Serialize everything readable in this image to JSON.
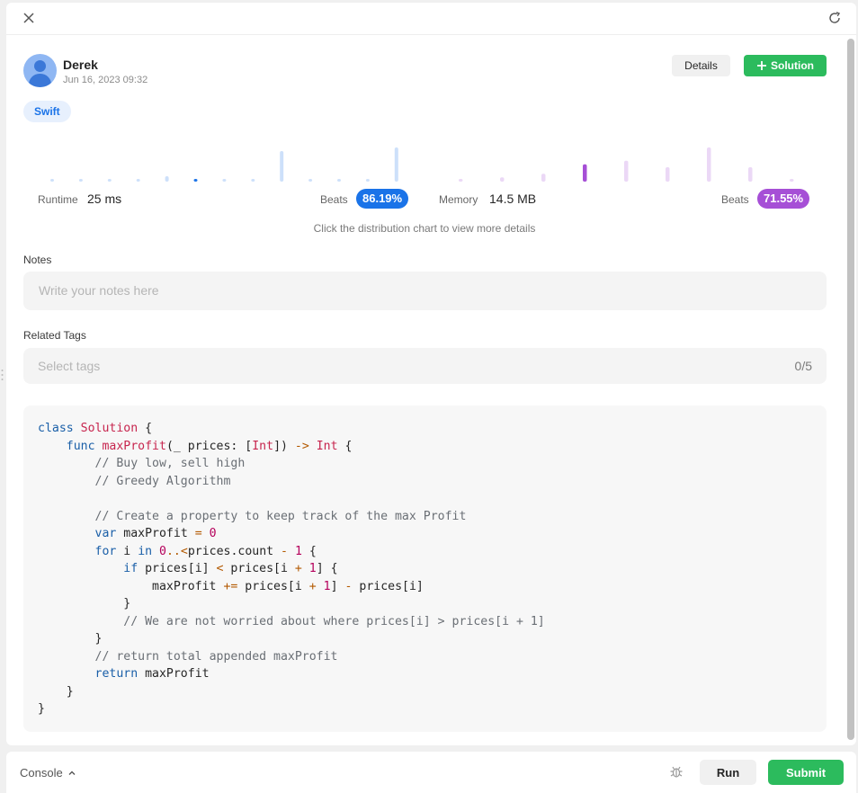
{
  "user": {
    "name": "Derek",
    "date": "Jun 16, 2023 09:32"
  },
  "actions": {
    "details_label": "Details",
    "solution_label": "Solution"
  },
  "language_tag": "Swift",
  "runtime": {
    "label": "Runtime",
    "value": "25 ms",
    "beats_label": "Beats",
    "beats_value": "86.19%",
    "accent": "#1a73e8",
    "bars": [
      0.04,
      0.04,
      0.04,
      0.04,
      0.15,
      0.07,
      0.04,
      0.06,
      0.85,
      0.04,
      0.04,
      0.06,
      0.95
    ],
    "highlight_index": 5
  },
  "memory": {
    "label": "Memory",
    "value": "14.5 MB",
    "beats_label": "Beats",
    "beats_value": "71.55%",
    "accent": "#a64fd6",
    "bars": [
      0.04,
      0.12,
      0.22,
      0.48,
      0.58,
      0.4,
      0.95,
      0.4,
      0.04
    ],
    "highlight_index": 3
  },
  "chart_hint": "Click the distribution chart to view more details",
  "notes": {
    "label": "Notes",
    "placeholder": "Write your notes here"
  },
  "tags": {
    "label": "Related Tags",
    "placeholder": "Select tags",
    "count": "0/5"
  },
  "code_lines": [
    "class Solution {",
    "    func maxProfit(_ prices: [Int]) -> Int {",
    "        // Buy low, sell high",
    "        // Greedy Algorithm",
    "",
    "        // Create a property to keep track of the max Profit",
    "        var maxProfit = 0",
    "        for i in 0..<prices.count - 1 {",
    "            if prices[i] < prices[i + 1] {",
    "                maxProfit += prices[i + 1] - prices[i]",
    "            }",
    "            // We are not worried about where prices[i] > prices[i + 1]",
    "        }",
    "        // return total appended maxProfit",
    "        return maxProfit",
    "    }",
    "}"
  ],
  "bottom": {
    "console_label": "Console",
    "run_label": "Run",
    "submit_label": "Submit"
  },
  "colors": {
    "brand_green": "#2cbb5d",
    "runtime_blue": "#1a73e8",
    "memory_purple": "#a64fd6"
  }
}
